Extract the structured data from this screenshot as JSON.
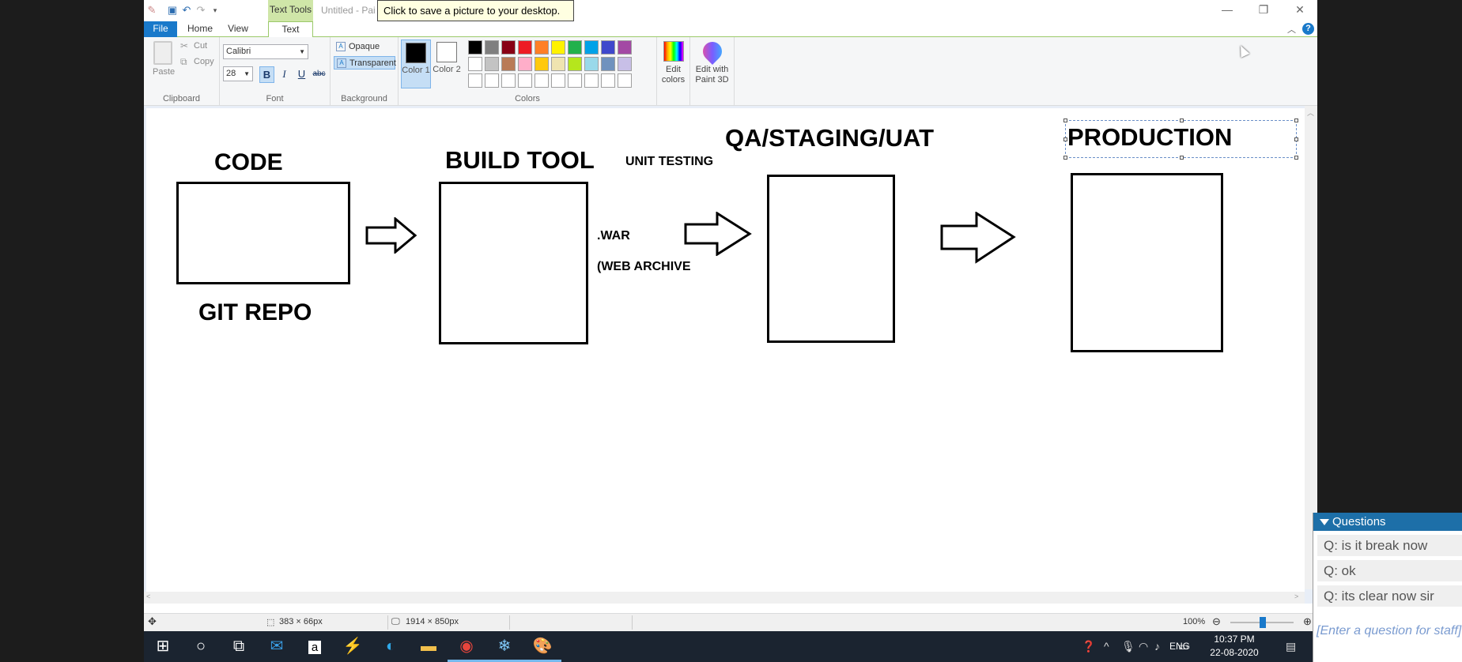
{
  "window": {
    "context_tab": "Text Tools",
    "title": "Untitled - Pai",
    "tooltip": "Click to save a picture to your desktop."
  },
  "tabs": {
    "file": "File",
    "home": "Home",
    "view": "View",
    "text": "Text"
  },
  "clipboard": {
    "paste": "Paste",
    "cut": "Cut",
    "copy": "Copy",
    "label": "Clipboard"
  },
  "font": {
    "family": "Calibri",
    "size": "28",
    "bold": "B",
    "italic": "I",
    "underline": "U",
    "strike": "abc",
    "label": "Font"
  },
  "background": {
    "opaque": "Opaque",
    "transparent": "Transparent",
    "label": "Background"
  },
  "colors": {
    "color1": "Color 1",
    "color2": "Color 2",
    "edit_colors": "Edit colors",
    "label": "Colors",
    "color1_value": "#000000",
    "color2_value": "#ffffff",
    "palette_row1": [
      "#000000",
      "#7f7f7f",
      "#880015",
      "#ed1c24",
      "#ff7f27",
      "#fff200",
      "#22b14c",
      "#00a2e8",
      "#3f48cc",
      "#a349a4"
    ],
    "palette_row2": [
      "#ffffff",
      "#c3c3c3",
      "#b97a57",
      "#ffaec9",
      "#ffc90e",
      "#efe4b0",
      "#b5e61d",
      "#99d9ea",
      "#7092be",
      "#c8bfe7"
    ],
    "palette_row3": [
      "#ffffff",
      "#ffffff",
      "#ffffff",
      "#ffffff",
      "#ffffff",
      "#ffffff",
      "#ffffff",
      "#ffffff",
      "#ffffff",
      "#ffffff"
    ]
  },
  "paint3d": {
    "label": "Edit with Paint 3D"
  },
  "canvas": {
    "code": "CODE",
    "git_repo": "GIT REPO",
    "build_tool": "BUILD TOOL",
    "unit_testing": "UNIT TESTING",
    "war": ".WAR",
    "web_archive": "(WEB ARCHIVE",
    "qa": "QA/STAGING/UAT",
    "production": "PRODUCTION"
  },
  "status": {
    "selection": "383 × 66px",
    "canvas_size": "1914 × 850px",
    "zoom": "100%"
  },
  "questions": {
    "header": "Questions",
    "items": [
      "Q: is it break now",
      "Q: ok",
      "Q: its clear now sir"
    ],
    "input_placeholder": "[Enter a question for staff]"
  },
  "taskbar": {
    "lang": "ENG",
    "time": "10:37 PM",
    "date": "22-08-2020"
  }
}
